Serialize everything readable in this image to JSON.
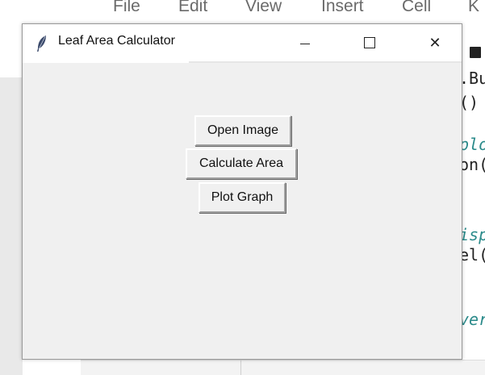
{
  "background": {
    "menu": [
      "File",
      "Edit",
      "View",
      "Insert",
      "Cell",
      "K"
    ],
    "code_lines": [
      {
        "text": ".Bu",
        "style": "dark"
      },
      {
        "text": "()",
        "style": "dark"
      },
      {
        "text": "plo",
        "style": "teal"
      },
      {
        "text": "on(",
        "style": "dark"
      },
      {
        "text": "isp",
        "style": "teal"
      },
      {
        "text": "el(",
        "style": "dark"
      },
      {
        "text": "ver",
        "style": "teal"
      }
    ]
  },
  "window": {
    "title": "Leaf Area Calculator",
    "icon": "feather-icon",
    "controls": {
      "minimize": "minimize-icon",
      "maximize": "maximize-icon",
      "close": "close-icon",
      "close_glyph": "✕"
    },
    "buttons": {
      "open_image": "Open Image",
      "calculate_area": "Calculate Area",
      "plot_graph": "Plot Graph"
    }
  },
  "colors": {
    "window_bg": "#f0f0f0",
    "titlebar_bg": "#ffffff",
    "code_teal": "#2a8a8a"
  }
}
